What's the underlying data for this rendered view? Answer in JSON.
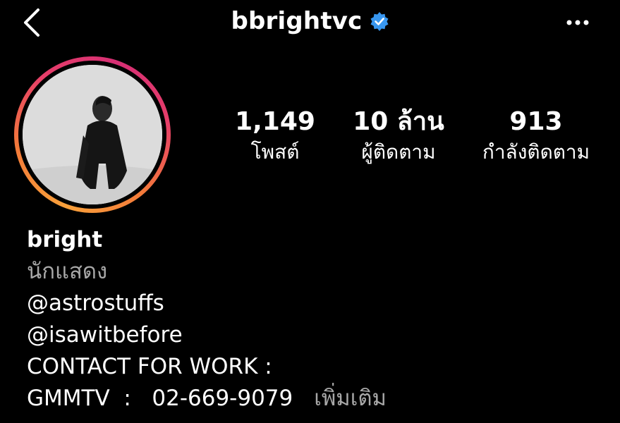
{
  "header": {
    "username": "bbrightvc",
    "icons": {
      "back": "chevron-left-icon",
      "verified": "verified-badge-icon",
      "more": "more-horizontal-icon"
    },
    "verified_color": "#3897f0"
  },
  "stats": {
    "posts": {
      "value": "1,149",
      "label": "โพสต์"
    },
    "followers": {
      "value": "10 ล้าน",
      "label": "ผู้ติดตาม"
    },
    "following": {
      "value": "913",
      "label": "กำลังติดตาม"
    }
  },
  "bio": {
    "name": "bright",
    "category": "นักแสดง",
    "lines": [
      "@astrostuffs",
      "@isawitbefore",
      "CONTACT FOR WORK :",
      "GMMTV  :   02-669-9079"
    ],
    "more_label": "เพิ่มเติม"
  },
  "colors": {
    "background": "#000000",
    "text": "#ffffff",
    "muted": "#a8a8a8",
    "story_ring": [
      "#f9a13b",
      "#e73e6a",
      "#d62f74"
    ]
  }
}
